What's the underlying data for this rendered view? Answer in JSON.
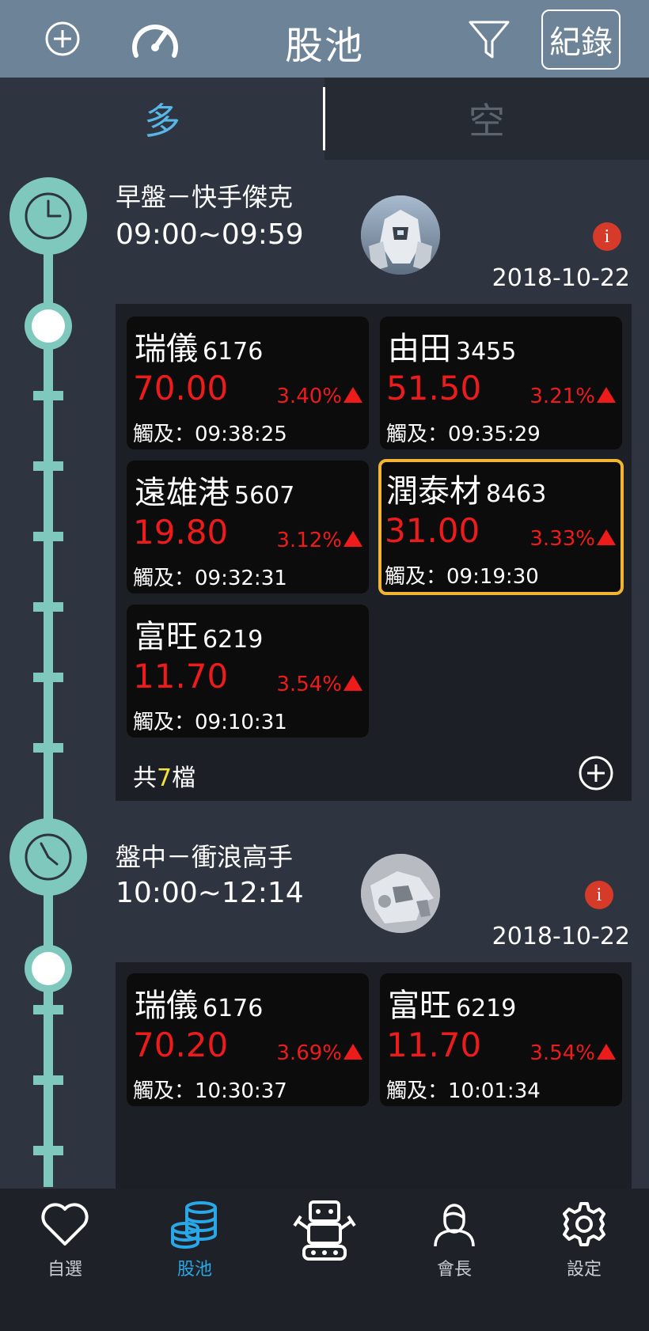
{
  "header": {
    "title": "股池",
    "record_label": "紀錄",
    "icons": [
      "add-circle-icon",
      "speedometer-icon",
      "filter-icon"
    ]
  },
  "tabs": [
    {
      "label": "多",
      "active": true
    },
    {
      "label": "空",
      "active": false
    }
  ],
  "sessions": [
    {
      "name": "早盤－快手傑克",
      "time_range": "09:00~09:59",
      "date": "2018-10-22",
      "total_prefix": "共",
      "total_count": "7",
      "total_suffix": "檔",
      "stocks": [
        {
          "name": "瑞儀",
          "code": "6176",
          "price": "70.00",
          "change": "3.40%",
          "trigger": "觸及：09:38:25"
        },
        {
          "name": "由田",
          "code": "3455",
          "price": "51.50",
          "change": "3.21%",
          "trigger": "觸及：09:35:29"
        },
        {
          "name": "遠雄港",
          "code": "5607",
          "price": "19.80",
          "change": "3.12%",
          "trigger": "觸及：09:32:31"
        },
        {
          "name": "潤泰材",
          "code": "8463",
          "price": "31.00",
          "change": "3.33%",
          "trigger": "觸及：09:19:30",
          "selected": true
        },
        {
          "name": "富旺",
          "code": "6219",
          "price": "11.70",
          "change": "3.54%",
          "trigger": "觸及：09:10:31"
        }
      ]
    },
    {
      "name": "盤中－衝浪高手",
      "time_range": "10:00~12:14",
      "date": "2018-10-22",
      "stocks": [
        {
          "name": "瑞儀",
          "code": "6176",
          "price": "70.20",
          "change": "3.69%",
          "trigger": "觸及：10:30:37"
        },
        {
          "name": "富旺",
          "code": "6219",
          "price": "11.70",
          "change": "3.54%",
          "trigger": "觸及：10:01:34"
        }
      ]
    }
  ],
  "bottom_nav": [
    {
      "label": "自選",
      "icon": "heart-icon",
      "active": false
    },
    {
      "label": "股池",
      "icon": "coins-stack-icon",
      "active": true
    },
    {
      "label": "",
      "icon": "robot-icon",
      "active": false
    },
    {
      "label": "會長",
      "icon": "person-icon",
      "active": false
    },
    {
      "label": "設定",
      "icon": "gear-icon",
      "active": false
    }
  ],
  "colors": {
    "header_bg": "#6d8498",
    "accent_blue": "#2aa7e6",
    "timeline": "#7fc8bd",
    "price_red": "#ee1b1b",
    "highlight_border": "#f2b532",
    "count_yellow": "#f5e13c"
  }
}
